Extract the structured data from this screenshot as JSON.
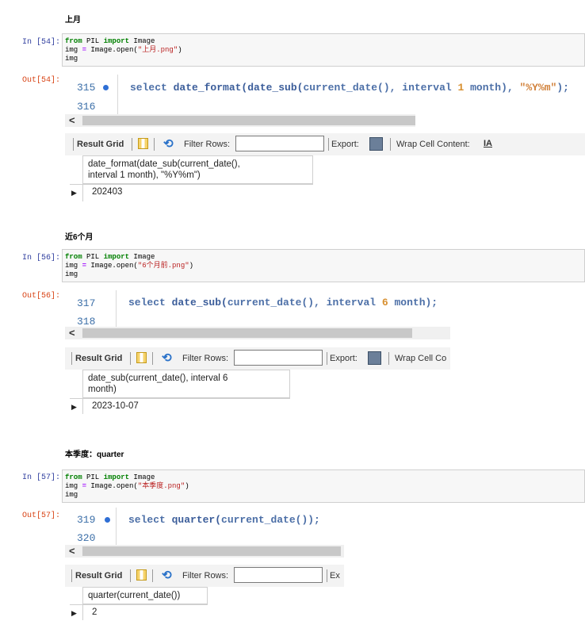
{
  "sections": [
    {
      "heading": "上月",
      "in_prompt": "In  [54]:",
      "out_prompt": "Out[54]:",
      "code": {
        "line1_kw1": "from",
        "line1_mod": " PIL ",
        "line1_kw2": "import",
        "line1_rest": " Image",
        "line2_a": "img ",
        "line2_op": "=",
        "line2_b": " Image.open(",
        "line2_str": "\"上月.png\"",
        "line2_c": ")",
        "line3": "img"
      },
      "editor": {
        "line_a": "315",
        "line_b": "316",
        "sql_kw": "select ",
        "sql_fn1": "date_format(date_sub(",
        "sql_fn2": "current_date(), ",
        "sql_kw2": "interval ",
        "sql_num": "1",
        "sql_kw3": " month), ",
        "sql_str": "\"%Y%m\"",
        "sql_end": ");"
      },
      "toolbar": {
        "result_grid": "Result Grid",
        "filter_rows": "Filter Rows:",
        "export": "Export:",
        "wrap": "Wrap Cell Content:",
        "wrap_icon": "IA"
      },
      "result": {
        "header_line1": "date_format(date_sub(current_date(),",
        "header_line2": "interval 1 month), \"%Y%m\")",
        "value": "202403"
      }
    },
    {
      "heading": "近6个月",
      "in_prompt": "In  [56]:",
      "out_prompt": "Out[56]:",
      "code": {
        "line1_kw1": "from",
        "line1_mod": " PIL ",
        "line1_kw2": "import",
        "line1_rest": " Image",
        "line2_a": "img ",
        "line2_op": "=",
        "line2_b": " Image.open(",
        "line2_str": "\"6个月前.png\"",
        "line2_c": ")",
        "line3": "img"
      },
      "editor": {
        "line_a": "317",
        "line_b": "318",
        "sql_kw": "select ",
        "sql_fn1": "date_sub(",
        "sql_fn2": "current_date(), ",
        "sql_kw2": "interval ",
        "sql_num": "6",
        "sql_kw3": " month);"
      },
      "toolbar": {
        "result_grid": "Result Grid",
        "filter_rows": "Filter Rows:",
        "export": "Export:",
        "wrap": "Wrap Cell Co"
      },
      "result": {
        "header_line1": "date_sub(current_date(), interval 6",
        "header_line2": "month)",
        "value": "2023-10-07"
      }
    },
    {
      "heading": "本季度：quarter",
      "in_prompt": "In  [57]:",
      "out_prompt": "Out[57]:",
      "code": {
        "line1_kw1": "from",
        "line1_mod": " PIL ",
        "line1_kw2": "import",
        "line1_rest": " Image",
        "line2_a": "img ",
        "line2_op": "=",
        "line2_b": " Image.open(",
        "line2_str": "\"本季度.png\"",
        "line2_c": ")",
        "line3": "img"
      },
      "editor": {
        "line_a": "319",
        "line_b": "320",
        "sql_kw": "select ",
        "sql_fn1": "quarter(",
        "sql_fn2": "current_date());"
      },
      "toolbar": {
        "result_grid": "Result Grid",
        "filter_rows": "Filter Rows:",
        "export": "Ex"
      },
      "result": {
        "header_line1": "quarter(current_date())",
        "value": "2"
      }
    }
  ]
}
